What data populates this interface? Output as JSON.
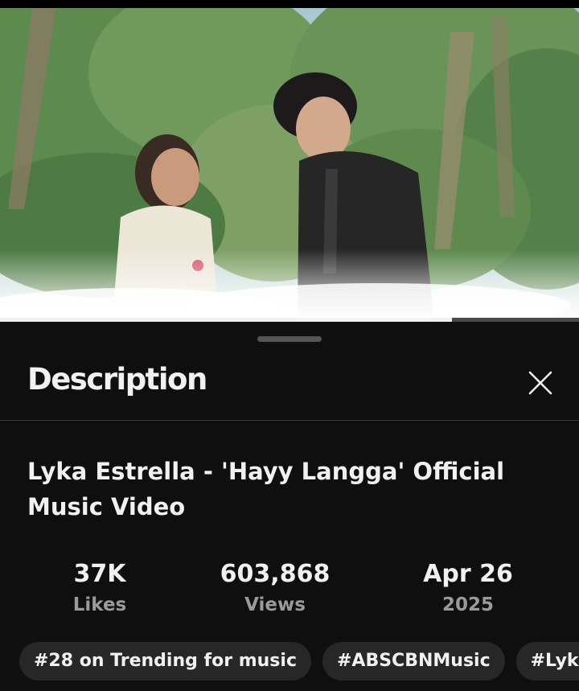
{
  "video": {
    "progress_fraction": 0.78
  },
  "description_sheet": {
    "title": "Description",
    "close_icon": "close-icon",
    "video_title": "Lyka Estrella - 'Hayy Langga' Official Music Video",
    "stats": [
      {
        "value": "37K",
        "label": "Likes"
      },
      {
        "value": "603,868",
        "label": "Views"
      },
      {
        "value": "Apr 26",
        "label": "2025"
      }
    ],
    "chips": [
      "#28 on Trending for music",
      "#ABSCBNMusic",
      "#Lyka"
    ]
  },
  "colors": {
    "background": "#0f0f0f",
    "text_primary": "#f1f1f1",
    "text_secondary": "#9a9a9a",
    "chip_bg": "#272727"
  }
}
